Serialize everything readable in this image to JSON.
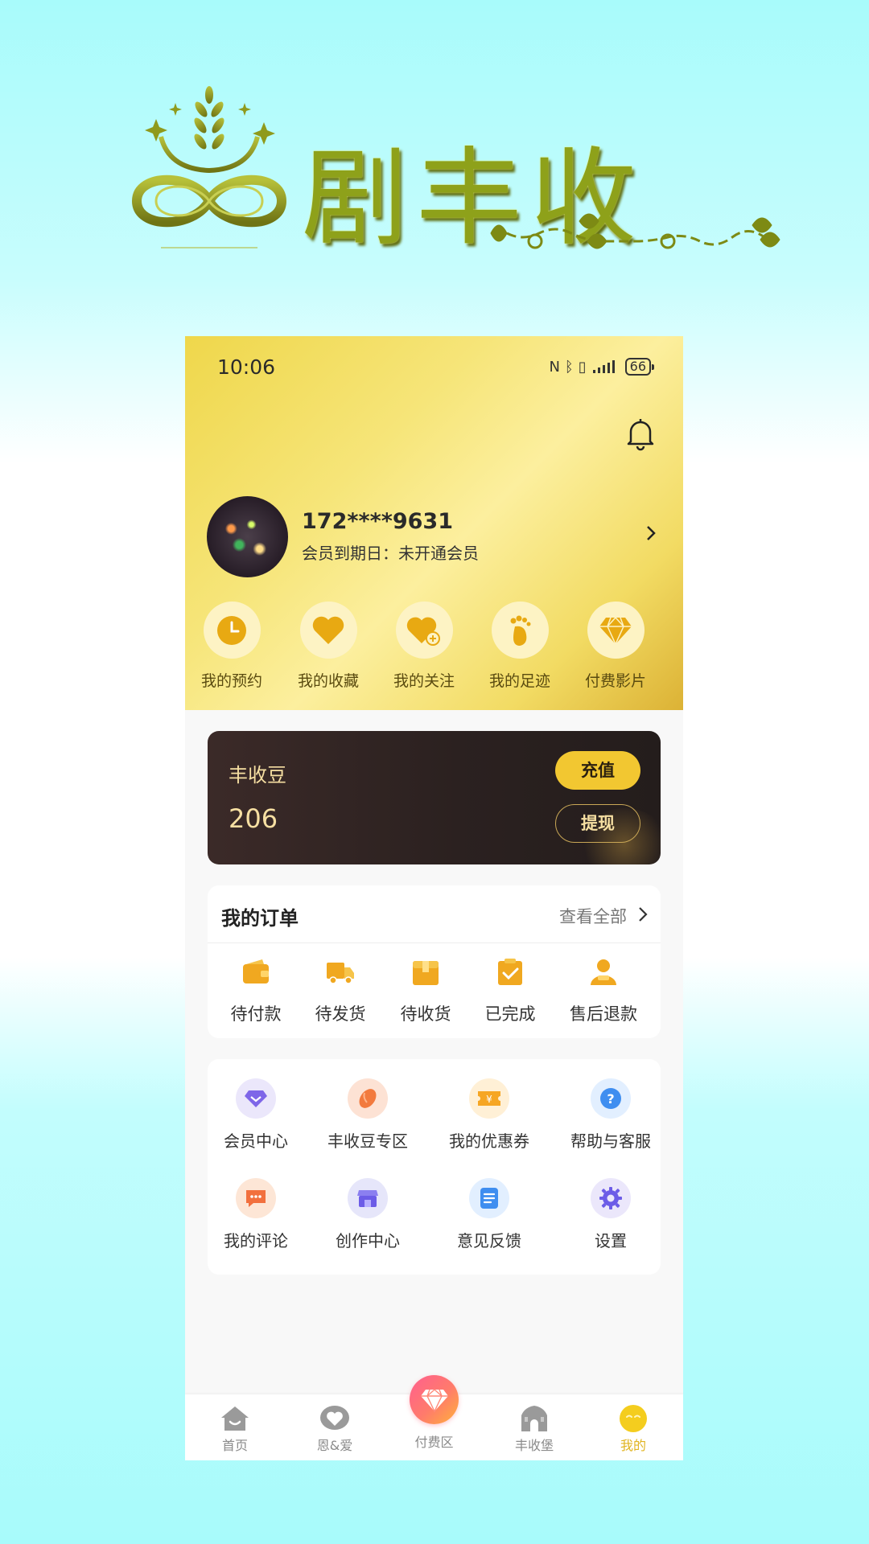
{
  "logo": {
    "text": "剧丰收"
  },
  "status_bar": {
    "time": "10:06",
    "battery": "66"
  },
  "profile": {
    "phone": "172****9631",
    "member_expiry": "会员到期日：未开通会员"
  },
  "quick_actions": [
    {
      "label": "我的预约",
      "icon": "clock-icon"
    },
    {
      "label": "我的收藏",
      "icon": "heart-icon"
    },
    {
      "label": "我的关注",
      "icon": "heart-plus-icon"
    },
    {
      "label": "我的足迹",
      "icon": "footprint-icon"
    },
    {
      "label": "付费影片",
      "icon": "diamond-icon"
    }
  ],
  "beans": {
    "title": "丰收豆",
    "value": "206",
    "recharge_label": "充值",
    "withdraw_label": "提现"
  },
  "orders": {
    "title": "我的订单",
    "view_all": "查看全部",
    "items": [
      {
        "label": "待付款",
        "icon": "wallet-icon"
      },
      {
        "label": "待发货",
        "icon": "truck-icon"
      },
      {
        "label": "待收货",
        "icon": "package-icon"
      },
      {
        "label": "已完成",
        "icon": "clipboard-check-icon"
      },
      {
        "label": "售后退款",
        "icon": "service-agent-icon"
      }
    ]
  },
  "services": [
    {
      "label": "会员中心",
      "icon": "vip-diamond-icon"
    },
    {
      "label": "丰收豆专区",
      "icon": "bean-icon"
    },
    {
      "label": "我的优惠券",
      "icon": "coupon-icon"
    },
    {
      "label": "帮助与客服",
      "icon": "help-icon"
    },
    {
      "label": "我的评论",
      "icon": "comment-icon"
    },
    {
      "label": "创作中心",
      "icon": "creator-store-icon"
    },
    {
      "label": "意见反馈",
      "icon": "feedback-icon"
    },
    {
      "label": "设置",
      "icon": "settings-gear-icon"
    }
  ],
  "tabbar": [
    {
      "label": "首页",
      "icon": "home-icon"
    },
    {
      "label": "恩&爱",
      "icon": "love-icon"
    },
    {
      "label": "付费区",
      "icon": "diamond-icon"
    },
    {
      "label": "丰收堡",
      "icon": "castle-icon"
    },
    {
      "label": "我的",
      "icon": "profile-face-icon",
      "active": true
    }
  ],
  "colors": {
    "accent_gold": "#f2c731",
    "tab_active": "#e0b420",
    "card_dark": "#2b2120",
    "beans_text": "#f6dfa2"
  }
}
